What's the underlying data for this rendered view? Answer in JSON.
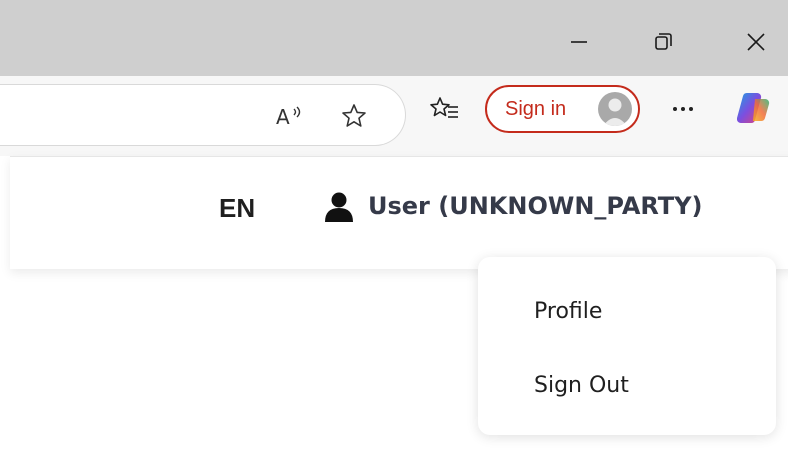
{
  "window": {
    "minimize_icon": "minimize-icon",
    "restore_icon": "restore-icon",
    "close_icon": "close-icon"
  },
  "toolbar": {
    "read_aloud_icon": "read-aloud-icon",
    "favorite_icon": "star-icon",
    "favorites_icon": "favorites-list-icon",
    "sign_in_label": "Sign in",
    "sign_in_color": "#c42b1c",
    "more_icon": "more-icon",
    "copilot_icon": "copilot-icon"
  },
  "header": {
    "language": "EN",
    "user_label": "User (UNKNOWN_PARTY)"
  },
  "user_menu": {
    "items": [
      "Profile",
      "Sign Out"
    ]
  }
}
